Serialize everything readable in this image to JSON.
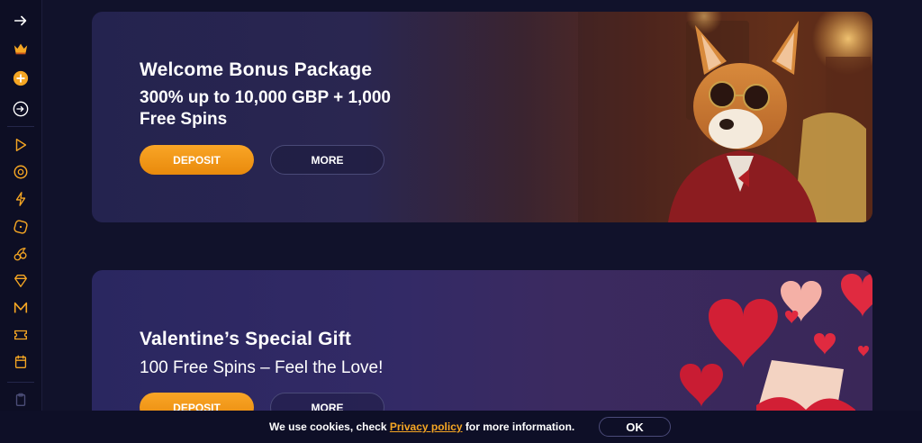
{
  "sidebar": {
    "icons": [
      "arrow-right-icon",
      "crown-icon",
      "plus-circle-icon",
      "login-icon",
      "play-icon",
      "chip-icon",
      "lightning-icon",
      "dice-icon",
      "cherries-icon",
      "diamond-icon",
      "m-icon",
      "ticket-icon",
      "calendar-icon",
      "clipboard-icon"
    ]
  },
  "banners": [
    {
      "title": "Welcome Bonus Package",
      "subtitle_line1": "300% up to 10,000 GBP + 1,000",
      "subtitle_line2": "Free Spins",
      "deposit_label": "DEPOSIT",
      "more_label": "MORE"
    },
    {
      "title": "Valentine’s Special Gift",
      "subtitle_line1": "100 Free Spins – Feel the Love!",
      "deposit_label": "DEPOSIT",
      "more_label": "MORE"
    }
  ],
  "cookie": {
    "text_before": "We use cookies, check ",
    "link_label": "Privacy policy",
    "text_after": " for more information.",
    "ok_label": "OK"
  },
  "colors": {
    "accent": "#f5a623",
    "background": "#11122b",
    "sidebar_icon": "#f5a623"
  }
}
